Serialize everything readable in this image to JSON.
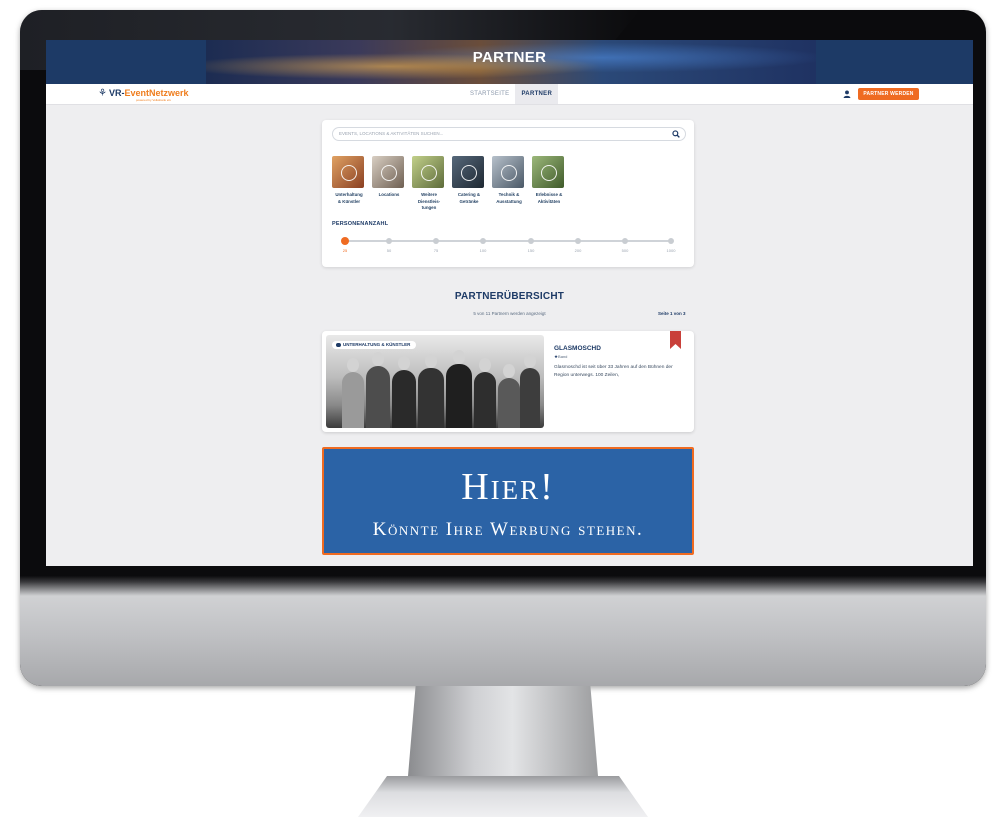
{
  "hero": {
    "title": "PARTNER"
  },
  "logo": {
    "brand_prefix": "VR-",
    "brand_main": "EventNetzwerk",
    "tagline": "powered by Volksbank eG"
  },
  "nav": {
    "links": [
      {
        "label": "STARTSEITE",
        "active": false
      },
      {
        "label": "PARTNER",
        "active": true
      }
    ],
    "user_icon": "user-icon",
    "cta_label": "PARTNER WERDEN"
  },
  "search": {
    "placeholder": "EVENTS, LOCATIONS & AKTIVITÄTEN SUCHEN...",
    "icon": "search-icon"
  },
  "categories": [
    {
      "label_line1": "Unterhaltung",
      "label_line2": "& Künstler",
      "label_line3": "",
      "color": "#b36a3a"
    },
    {
      "label_line1": "Locations",
      "label_line2": "",
      "label_line3": "",
      "color": "#9a8a7c"
    },
    {
      "label_line1": "Weitere",
      "label_line2": "Dienstleis-",
      "label_line3": "tungen",
      "color": "#8fa06a"
    },
    {
      "label_line1": "Catering &",
      "label_line2": "Getränke",
      "label_line3": "",
      "color": "#3a4654"
    },
    {
      "label_line1": "Technik &",
      "label_line2": "Ausstattung",
      "label_line3": "",
      "color": "#7b8a98"
    },
    {
      "label_line1": "Erlebnisse &",
      "label_line2": "Aktivitäten",
      "label_line3": "",
      "color": "#6d8a56"
    }
  ],
  "persons": {
    "label": "PERSONENANZAHL",
    "ticks": [
      "25",
      "50",
      "75",
      "100",
      "150",
      "200",
      "500",
      "1000"
    ],
    "selected": "25"
  },
  "overview": {
    "title": "PARTNERÜBERSICHT",
    "count_text": "5 von 11 Partnern werden angezeigt",
    "page_text": "Seite 1 von 3"
  },
  "partner": {
    "category_badge": "UNTERHALTUNG & KÜNSTLER",
    "name": "GLASMOSCHD",
    "type": "Band",
    "description": "Glasmoschd ist seit über 33 Jahren auf den Bühnen der Region unterwegs. 100 Zeilen,",
    "bookmark_color": "#c9403a"
  },
  "ad": {
    "headline": "Hier!",
    "subline": "Könnte Ihre Werbung stehen."
  },
  "colors": {
    "navy": "#1d3a66",
    "accent": "#ef6b22",
    "ad_blue": "#2b63a6"
  }
}
